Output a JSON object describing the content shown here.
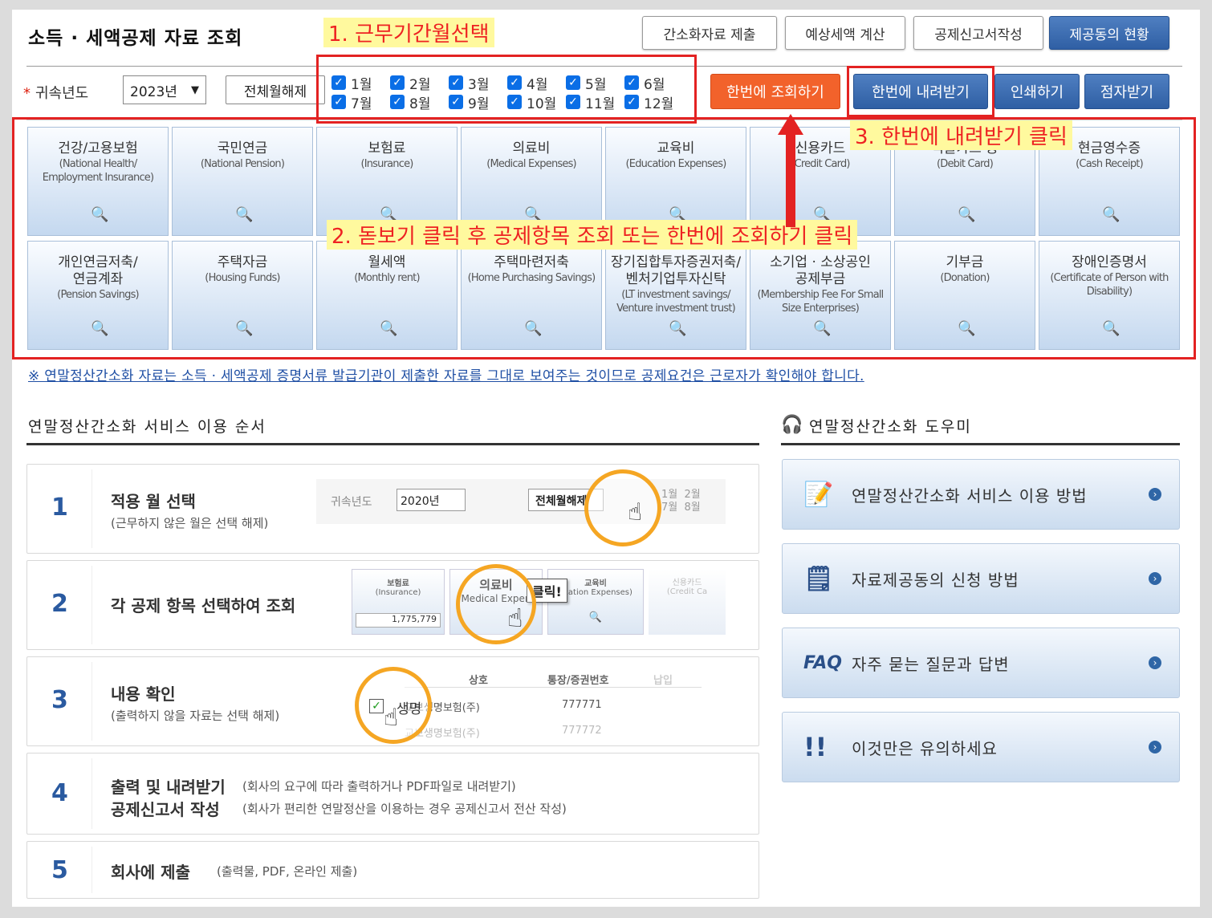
{
  "header": {
    "title": "소득 · 세액공제 자료 조회"
  },
  "top_buttons": [
    "간소화자료 제출",
    "예상세액 계산",
    "공제신고서작성",
    "제공동의 현황"
  ],
  "toolbar": {
    "year_label": "귀속년도",
    "year_value": "2023년",
    "all_months_label": "전체월해제",
    "months": [
      "1월",
      "2월",
      "3월",
      "4월",
      "5월",
      "6월",
      "7월",
      "8월",
      "9월",
      "10월",
      "11월",
      "12월"
    ],
    "query_all": "한번에 조회하기",
    "download_all": "한번에 내려받기",
    "print": "인쇄하기",
    "braille": "점자받기"
  },
  "tiles": [
    {
      "ko": "건강/고용보험",
      "en": "(National Health/ Employment Insurance)"
    },
    {
      "ko": "국민연금",
      "en": "(National Pension)"
    },
    {
      "ko": "보험료",
      "en": "(Insurance)"
    },
    {
      "ko": "의료비",
      "en": "(Medical Expenses)"
    },
    {
      "ko": "교육비",
      "en": "(Education Expenses)"
    },
    {
      "ko": "신용카드",
      "en": "(Credit Card)"
    },
    {
      "ko": "직불카드 등",
      "en": "(Debit Card)"
    },
    {
      "ko": "현금영수증",
      "en": "(Cash Receipt)"
    },
    {
      "ko": "개인연금저축/\n연금계좌",
      "en": "(Pension Savings)"
    },
    {
      "ko": "주택자금",
      "en": "(Housing Funds)"
    },
    {
      "ko": "월세액",
      "en": "(Monthly rent)"
    },
    {
      "ko": "주택마련저축",
      "en": "(Home Purchasing Savings)"
    },
    {
      "ko": "장기집합투자증권저축/\n벤처기업투자신탁",
      "en": "(LT investment savings/ Venture investment trust)"
    },
    {
      "ko": "소기업 · 소상공인\n공제부금",
      "en": "(Membership Fee For Small Size Enterprises)"
    },
    {
      "ko": "기부금",
      "en": "(Donation)"
    },
    {
      "ko": "장애인증명서",
      "en": "(Certificate of Person with Disability)"
    }
  ],
  "notice": "※ 연말정산간소화 자료는 소득 · 세액공제 증명서류 발급기관이 제출한 자료를 그대로 보여주는 것이므로 공제요건은 근로자가 확인해야 합니다.",
  "steps_section": {
    "title": "연말정산간소화 서비스 이용 순서",
    "steps": [
      {
        "num": "1",
        "t1": "적용 월 선택",
        "t2": "(근무하지 않은 월은 선택 해제)"
      },
      {
        "num": "2",
        "t1": "각 공제 항목 선택하여 조회",
        "t2": ""
      },
      {
        "num": "3",
        "t1": "내용 확인",
        "t2": "(출력하지 않을 자료는 선택 해제)"
      },
      {
        "num": "4",
        "t1": "출력 및 내려받기",
        "t1b": "공제신고서 작성",
        "t2": "(회사의 요구에 따라 출력하거나 PDF파일로 내려받기)",
        "t2b": "(회사가 편리한 연말정산을 이용하는 경우 공제신고서 전산 작성)"
      },
      {
        "num": "5",
        "t1": "회사에 제출",
        "t2": "(출력물, PDF, 온라인 제출)"
      }
    ],
    "thumb1": {
      "label": "귀속년도",
      "year": "2020년",
      "all": "전체월해제",
      "m1": "1월",
      "m2": "2월",
      "m7": "7월",
      "m8": "8월"
    },
    "thumb2": {
      "t1": "보험료",
      "t1e": "(Insurance)",
      "v1": "1,775,779",
      "t2": "의료비",
      "t2e": "Medical Expen",
      "click": "클릭!",
      "t3": "교육비",
      "t3e": "ucation Expenses)",
      "t4": "신용카드",
      "t4e": "(Credit Ca"
    },
    "thumb3": {
      "h1": "상호",
      "h2": "통장/증권번호",
      "h3": "납입",
      "r1a": "생명",
      "r1b": "교보생명보험(주)",
      "r1c": "777771",
      "r2b": "교보생명보험(주)",
      "r2c": "777772"
    }
  },
  "help_section": {
    "title": "연말정산간소화 도우미",
    "items": [
      {
        "icon": "doc",
        "text": "연말정산간소화 서비스 이용 방법"
      },
      {
        "icon": "form",
        "text": "자료제공동의 신청 방법"
      },
      {
        "icon": "FAQ",
        "text": "자주 묻는 질문과 답변"
      },
      {
        "icon": "!!",
        "text": "이것만은 유의하세요"
      }
    ]
  },
  "annotations": {
    "a1": "1. 근무기간월선택",
    "a2": "2. 돋보기 클릭 후 공제항목 조회 또는 한번에 조회하기 클릭",
    "a3": "3. 한번에 내려받기 클릭"
  }
}
